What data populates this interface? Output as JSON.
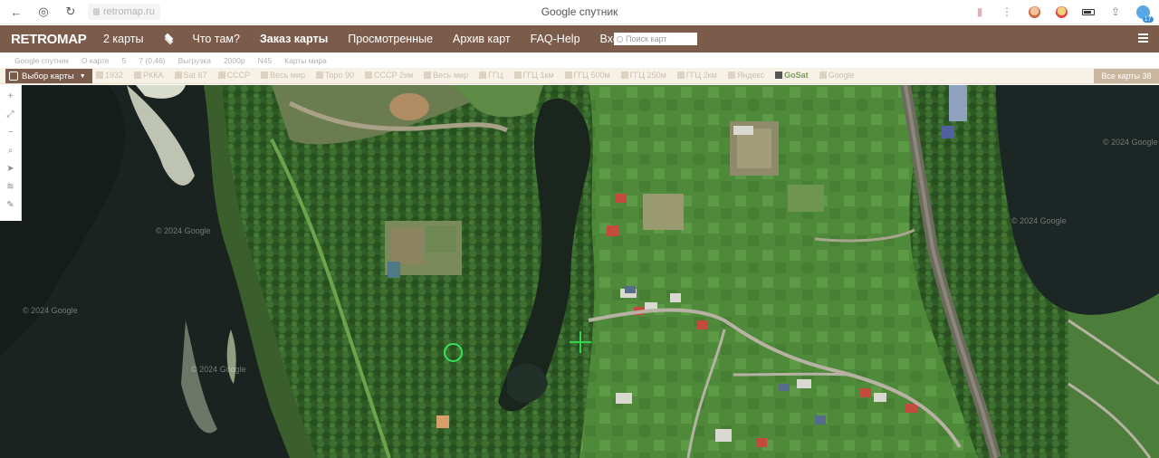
{
  "browser": {
    "url": "retromap.ru",
    "tab_title": "Google спутник"
  },
  "header": {
    "logo": "RETROMAP",
    "menu": [
      {
        "label": "2 карты"
      },
      {
        "label": "Что там?"
      },
      {
        "label": "Заказ карты"
      },
      {
        "label": "Просмотренные"
      },
      {
        "label": "Архив карт"
      },
      {
        "label": "FAQ-Help"
      },
      {
        "label": "Вход"
      }
    ],
    "search_placeholder": "Поиск карт"
  },
  "info_row": {
    "items": [
      "Google спутник",
      "О карте",
      "5",
      "7 (0,46)",
      "Выгрузка",
      "2000р",
      "N45",
      "Карты мира"
    ]
  },
  "map_bar": {
    "choose_label": "Выбор карты",
    "items": [
      "1932",
      "РККА",
      "Sat 67",
      "СССР",
      "Весь мир",
      "Topo 90",
      "СССР 2км",
      "Весь мир",
      "ГГЦ",
      "ГГЦ 1км",
      "ГГЦ 500м",
      "ГГЦ 250м",
      "ГГЦ 2км",
      "Яндекс",
      "GoSat",
      "Google"
    ],
    "active_item": "GoSat",
    "all_maps_label": "Все карты 38"
  },
  "map": {
    "watermarks": [
      "© 2024 Google",
      "© 2024 Google",
      "© 2024 Google",
      "© 2024 Google",
      "© 2024 Google"
    ],
    "accent_color": "#31d64a"
  }
}
